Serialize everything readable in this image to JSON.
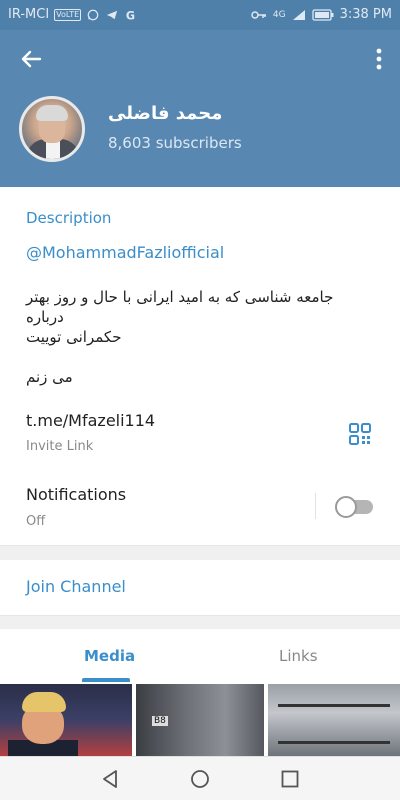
{
  "status_bar": {
    "carrier": "IR-MCI",
    "volte": "VoLTE",
    "network": "4G",
    "time": "3:38 PM"
  },
  "header": {
    "channel_name": "محمد فاضلی",
    "subscribers": "8,603 subscribers"
  },
  "info": {
    "description_title": "Description",
    "handle": "@MohammadFazliofficial",
    "bio_lines": [
      "جامعه شناسی که به امید ایرانی با حال و روز بهتر درباره",
      "حکمرانی توییت",
      "",
      "می زنم"
    ],
    "invite_link": "t.me/Mfazeli114",
    "invite_link_label": "Invite Link",
    "notifications_label": "Notifications",
    "notifications_value": "Off",
    "notifications_enabled": false
  },
  "join_button": "Join Channel",
  "tabs": {
    "media": "Media",
    "links": "Links",
    "active": "Media"
  },
  "media_thumbnails": {
    "thumb2_label": "B8"
  },
  "colors": {
    "header_bg": "#5888b2",
    "accent": "#3a8ec9"
  }
}
